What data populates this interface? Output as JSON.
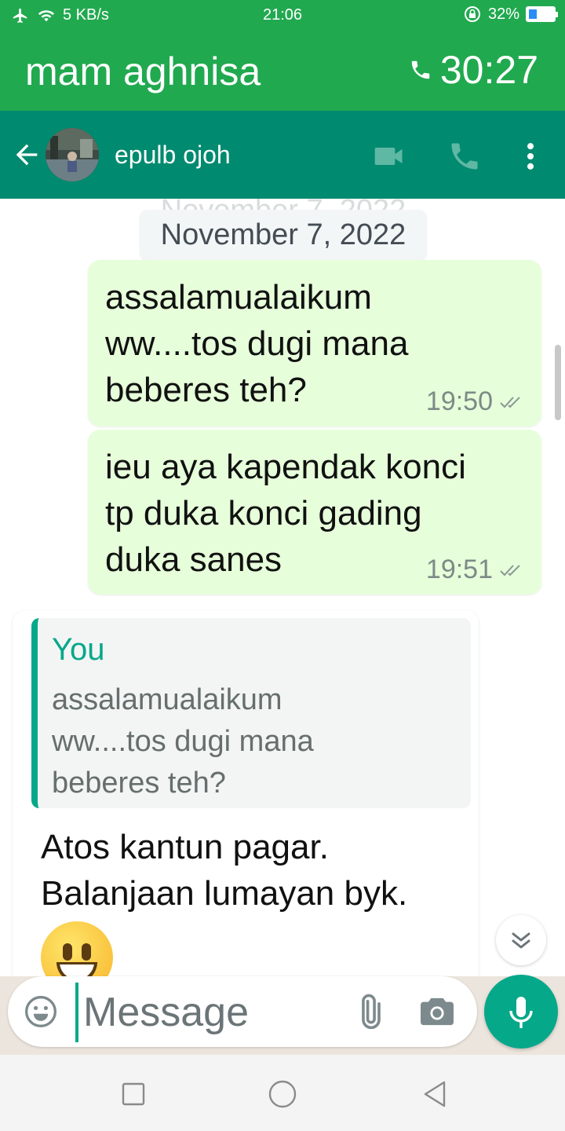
{
  "status_bar": {
    "network_speed": "5 KB/s",
    "time": "21:06",
    "battery": "32%",
    "battery_level": 0.32,
    "icons": [
      "airplane-icon",
      "wifi-icon",
      "rotation-lock-icon",
      "battery-icon"
    ]
  },
  "call_banner": {
    "caller_name": "mam aghnisa",
    "duration": "30:27",
    "icon": "phone-icon"
  },
  "chat_header": {
    "contact_name": "epulb ojoh",
    "icons": [
      "back-arrow-icon",
      "video-call-icon",
      "voice-call-icon",
      "more-options-icon"
    ]
  },
  "chat": {
    "date_chip": "November 7, 2022",
    "messages": [
      {
        "direction": "outgoing",
        "text": "assalamualaikum\nww....tos dugi mana\nbeberes teh?",
        "time": "19:50",
        "status": "read"
      },
      {
        "direction": "outgoing",
        "text": "ieu aya kapendak konci\ntp duka konci gading\nduka sanes",
        "time": "19:51",
        "status": "read"
      },
      {
        "direction": "incoming",
        "quote_author": "You",
        "quote_text": "assalamualaikum\nww....tos dugi mana\nbeberes teh?",
        "text": "Atos kantun pagar.\nBalanjaan lumayan byk.",
        "emoji": "grinning-face-icon"
      }
    ]
  },
  "composer": {
    "placeholder": "Message",
    "value": ""
  },
  "colors": {
    "status_green": "#21a94f",
    "header_teal": "#008a6f",
    "accent": "#06a88a",
    "outgoing_bubble": "#e6ffda",
    "quote_bg": "#f3f5f4"
  }
}
